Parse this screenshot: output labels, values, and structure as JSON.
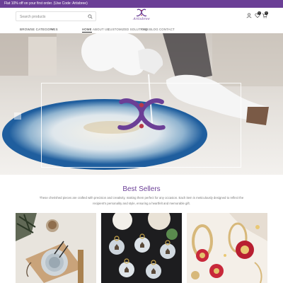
{
  "promo": {
    "text": "Flat 10% off on your first order. (Use Code: Artisbree)"
  },
  "search": {
    "placeholder": "Search products"
  },
  "brand": {
    "name": "Artisbree",
    "accent": "#6b3f96",
    "secondary": "#b83a4b"
  },
  "header": {
    "icons": [
      "user-icon",
      "heart-icon",
      "cart-icon"
    ],
    "wishlist_count": "0",
    "cart_count": "0"
  },
  "nav": {
    "browse_label": "BROWSE CATEGORIES",
    "items": [
      {
        "label": "HOME",
        "active": true
      },
      {
        "label": "ABOUT US"
      },
      {
        "label": "CUSTOMIZED SOLUTIONS"
      },
      {
        "label": "FAQ"
      },
      {
        "label": "BLOG"
      },
      {
        "label": "CONTACT"
      }
    ]
  },
  "best_sellers": {
    "title": "Best Sellers",
    "description": "These cherished pieces are crafted with precision and creativity, making them perfect for any occasion. Each item is meticulously designed to reflect the recipient's personality and style, ensuring a heartfelt and memorable gift."
  }
}
